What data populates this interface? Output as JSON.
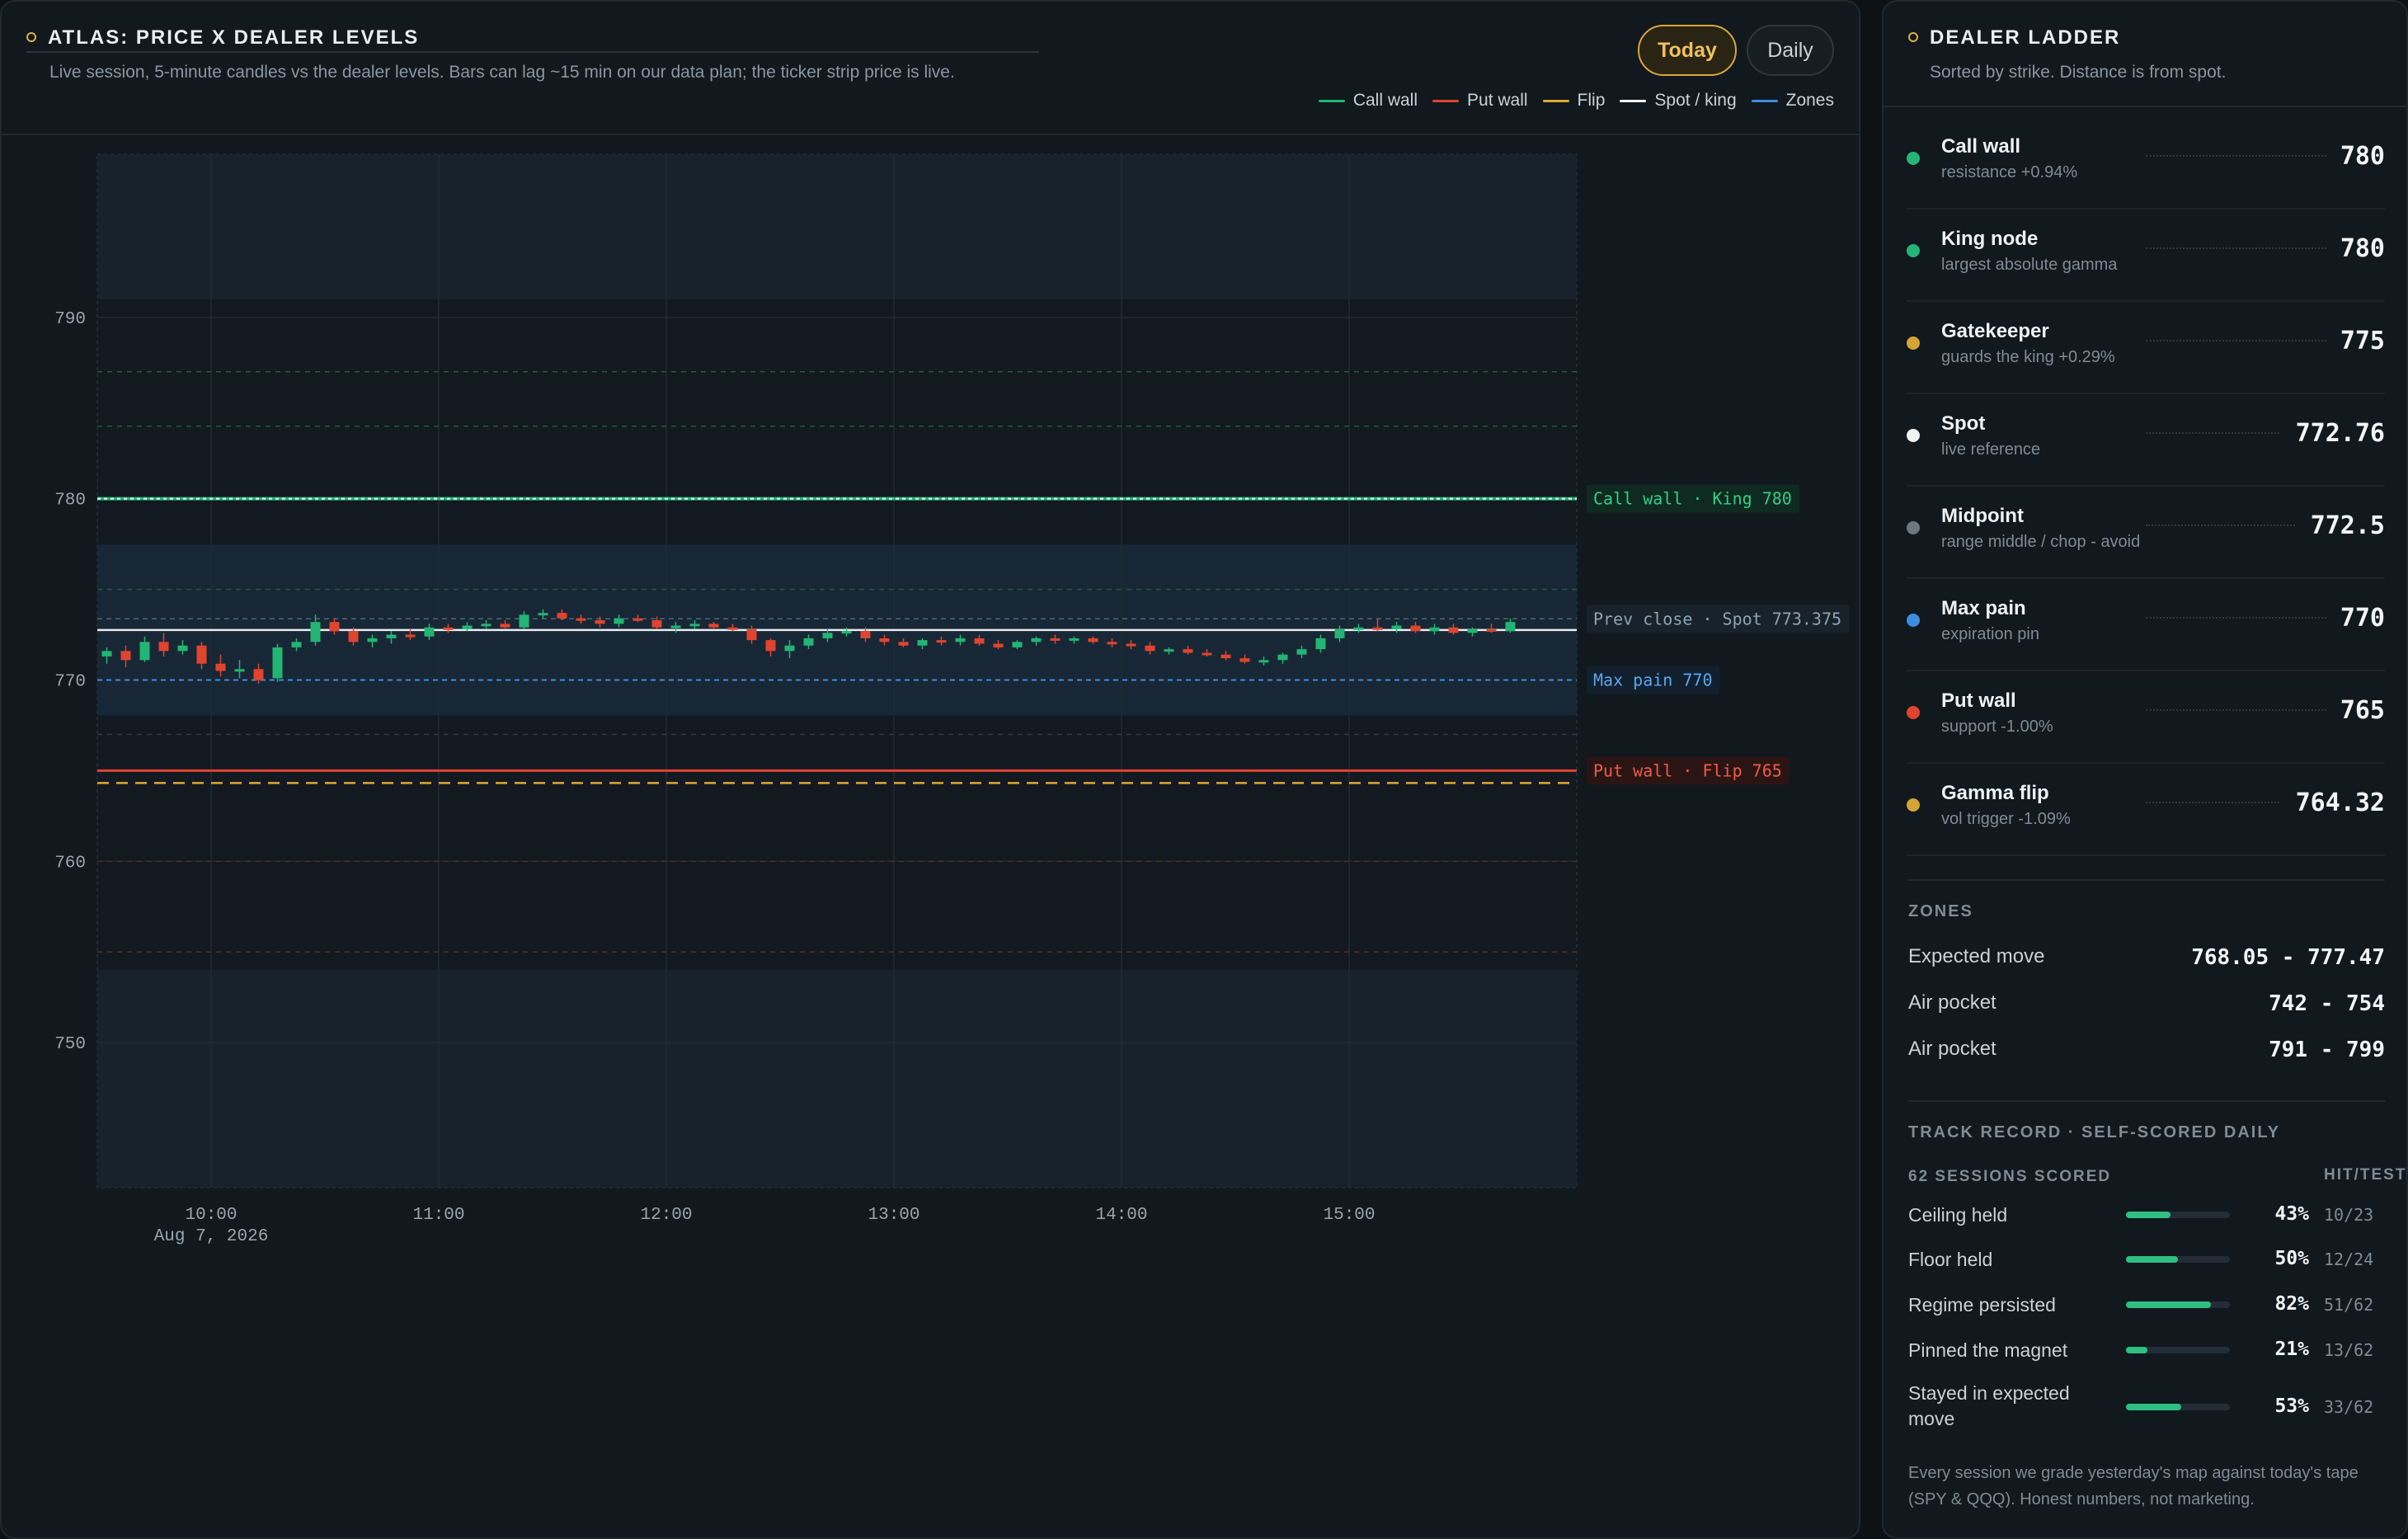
{
  "chart_panel": {
    "title": "ATLAS: PRICE X DEALER LEVELS",
    "subtitle": "Live session, 5-minute candles vs the dealer levels. Bars can lag ~15 min on our data plan; the ticker strip price is live.",
    "toggle": {
      "today": "Today",
      "daily": "Daily",
      "active": "Today"
    },
    "legend": [
      {
        "label": "Call wall",
        "color": "#22b573"
      },
      {
        "label": "Put wall",
        "color": "#e0442f"
      },
      {
        "label": "Flip",
        "color": "#e0a731"
      },
      {
        "label": "Spot / king",
        "color": "#ffffff"
      },
      {
        "label": "Zones",
        "color": "#3c8ee0"
      }
    ],
    "level_tags": {
      "call_king": "Call wall · King 780",
      "prev_spot": "Prev close · Spot 773.375",
      "max_pain": "Max pain 770",
      "put_flip": "Put wall · Flip 765"
    },
    "date_label": "Aug 7, 2026"
  },
  "chart_data": {
    "type": "candlestick",
    "x_ticks": [
      "10:00",
      "11:00",
      "12:00",
      "13:00",
      "14:00",
      "15:00"
    ],
    "y_ticks": [
      750,
      760,
      770,
      780,
      790
    ],
    "ylim": [
      742,
      799
    ],
    "session": {
      "start": "09:30",
      "end": "16:00",
      "interval_min": 5
    },
    "levels": {
      "call_wall": 780,
      "king_node": 780,
      "gatekeeper": 775,
      "spot": 772.76,
      "prev_close": 773.375,
      "midpoint": 772.5,
      "max_pain": 770,
      "put_wall": 765,
      "gamma_flip": 764.32,
      "expected_move": [
        768.05,
        777.47
      ],
      "air_pockets": [
        [
          742,
          754
        ],
        [
          791,
          799
        ]
      ]
    },
    "candles": [
      [
        771.3,
        771.8,
        770.9,
        771.6
      ],
      [
        771.6,
        771.9,
        770.7,
        771.1
      ],
      [
        771.1,
        772.4,
        771.0,
        772.1
      ],
      [
        772.1,
        772.6,
        771.3,
        771.6
      ],
      [
        771.6,
        772.2,
        771.4,
        771.9
      ],
      [
        771.9,
        772.1,
        770.6,
        770.9
      ],
      [
        770.9,
        771.4,
        770.2,
        770.5
      ],
      [
        770.5,
        771.1,
        770.1,
        770.6
      ],
      [
        770.6,
        770.9,
        769.8,
        770.0
      ],
      [
        770.1,
        772.0,
        769.9,
        771.8
      ],
      [
        771.8,
        772.3,
        771.6,
        772.1
      ],
      [
        772.1,
        773.6,
        771.9,
        773.2
      ],
      [
        773.2,
        773.4,
        772.5,
        772.7
      ],
      [
        772.7,
        772.9,
        771.9,
        772.1
      ],
      [
        772.1,
        772.5,
        771.8,
        772.3
      ],
      [
        772.3,
        772.7,
        772.0,
        772.5
      ],
      [
        772.5,
        772.8,
        772.2,
        772.4
      ],
      [
        772.4,
        773.1,
        772.2,
        772.9
      ],
      [
        772.9,
        773.1,
        772.6,
        772.8
      ],
      [
        772.8,
        773.2,
        772.7,
        773.0
      ],
      [
        773.0,
        773.3,
        772.8,
        773.1
      ],
      [
        773.1,
        773.3,
        772.8,
        772.9
      ],
      [
        772.9,
        773.8,
        772.8,
        773.6
      ],
      [
        773.6,
        773.9,
        773.4,
        773.7
      ],
      [
        773.7,
        773.9,
        773.3,
        773.4
      ],
      [
        773.4,
        773.6,
        773.1,
        773.3
      ],
      [
        773.3,
        773.5,
        772.9,
        773.1
      ],
      [
        773.1,
        773.6,
        772.9,
        773.4
      ],
      [
        773.4,
        773.6,
        773.2,
        773.3
      ],
      [
        773.3,
        773.5,
        772.8,
        772.9
      ],
      [
        772.9,
        773.2,
        772.6,
        773.0
      ],
      [
        773.0,
        773.3,
        772.8,
        773.1
      ],
      [
        773.1,
        773.2,
        772.8,
        772.9
      ],
      [
        772.9,
        773.1,
        772.7,
        772.8
      ],
      [
        772.8,
        773.0,
        772.0,
        772.2
      ],
      [
        772.2,
        772.3,
        771.3,
        771.6
      ],
      [
        771.6,
        772.2,
        771.2,
        771.9
      ],
      [
        771.9,
        772.5,
        771.7,
        772.3
      ],
      [
        772.3,
        772.8,
        772.1,
        772.6
      ],
      [
        772.6,
        772.9,
        772.4,
        772.7
      ],
      [
        772.7,
        772.9,
        772.1,
        772.3
      ],
      [
        772.3,
        772.5,
        771.9,
        772.1
      ],
      [
        772.1,
        772.3,
        771.8,
        771.9
      ],
      [
        771.9,
        772.3,
        771.7,
        772.2
      ],
      [
        772.2,
        772.4,
        771.9,
        772.1
      ],
      [
        772.1,
        772.5,
        771.9,
        772.3
      ],
      [
        772.3,
        772.5,
        771.9,
        772.0
      ],
      [
        772.0,
        772.2,
        771.7,
        771.8
      ],
      [
        771.8,
        772.2,
        771.7,
        772.1
      ],
      [
        772.1,
        772.4,
        771.9,
        772.3
      ],
      [
        772.3,
        772.5,
        772.0,
        772.2
      ],
      [
        772.2,
        772.4,
        772.0,
        772.3
      ],
      [
        772.3,
        772.4,
        772.0,
        772.1
      ],
      [
        772.1,
        772.3,
        771.8,
        772.0
      ],
      [
        772.0,
        772.2,
        771.7,
        771.9
      ],
      [
        771.9,
        772.1,
        771.4,
        771.6
      ],
      [
        771.6,
        771.8,
        771.4,
        771.7
      ],
      [
        771.7,
        771.9,
        771.4,
        771.5
      ],
      [
        771.5,
        771.7,
        771.3,
        771.4
      ],
      [
        771.4,
        771.6,
        771.1,
        771.2
      ],
      [
        771.2,
        771.4,
        770.9,
        771.0
      ],
      [
        771.0,
        771.3,
        770.8,
        771.1
      ],
      [
        771.1,
        771.5,
        770.9,
        771.4
      ],
      [
        771.4,
        771.9,
        771.2,
        771.7
      ],
      [
        771.7,
        772.5,
        771.5,
        772.3
      ],
      [
        772.3,
        773.0,
        772.1,
        772.8
      ],
      [
        772.8,
        773.1,
        772.6,
        772.9
      ],
      [
        772.9,
        773.4,
        772.7,
        772.8
      ],
      [
        772.8,
        773.2,
        772.6,
        773.0
      ],
      [
        773.0,
        773.2,
        772.6,
        772.7
      ],
      [
        772.7,
        773.1,
        772.5,
        772.9
      ],
      [
        772.9,
        773.1,
        772.5,
        772.6
      ],
      [
        772.6,
        772.9,
        772.4,
        772.8
      ],
      [
        772.8,
        773.1,
        772.6,
        772.7
      ],
      [
        772.7,
        773.4,
        772.6,
        773.2
      ]
    ]
  },
  "ladder_panel": {
    "title": "DEALER LADDER",
    "subtitle": "Sorted by strike. Distance is from spot.",
    "items": [
      {
        "name": "Call wall",
        "desc": "resistance +0.94%",
        "value": "780",
        "color": "#22b573"
      },
      {
        "name": "King node",
        "desc": "largest absolute gamma",
        "value": "780",
        "color": "#22b573"
      },
      {
        "name": "Gatekeeper",
        "desc": "guards the king +0.29%",
        "value": "775",
        "color": "#d4a534"
      },
      {
        "name": "Spot",
        "desc": "live reference",
        "value": "772.76",
        "color": "#f2f2f2"
      },
      {
        "name": "Midpoint",
        "desc": "range middle / chop - avoid",
        "value": "772.5",
        "color": "#6d7780"
      },
      {
        "name": "Max pain",
        "desc": "expiration pin",
        "value": "770",
        "color": "#3c8ee0"
      },
      {
        "name": "Put wall",
        "desc": "support -1.00%",
        "value": "765",
        "color": "#e0442f"
      },
      {
        "name": "Gamma flip",
        "desc": "vol trigger -1.09%",
        "value": "764.32",
        "color": "#d4a534"
      }
    ],
    "zones_label": "ZONES",
    "zones": [
      {
        "name": "Expected move",
        "value": "768.05 - 777.47"
      },
      {
        "name": "Air pocket",
        "value": "742 - 754"
      },
      {
        "name": "Air pocket",
        "value": "791 - 799"
      }
    ],
    "track": {
      "label": "TRACK RECORD · SELF-SCORED DAILY",
      "sessions": "62 SESSIONS SCORED",
      "col_header": "HIT/TEST",
      "rows": [
        {
          "name": "Ceiling held",
          "pct": "43%",
          "count": "10/23",
          "fraction": 0.43
        },
        {
          "name": "Floor held",
          "pct": "50%",
          "count": "12/24",
          "fraction": 0.5
        },
        {
          "name": "Regime persisted",
          "pct": "82%",
          "count": "51/62",
          "fraction": 0.82
        },
        {
          "name": "Pinned the magnet",
          "pct": "21%",
          "count": "13/62",
          "fraction": 0.21
        },
        {
          "name": "Stayed in expected move",
          "pct": "53%",
          "count": "33/62",
          "fraction": 0.53
        }
      ],
      "footnote": "Every session we grade yesterday's map against today's tape (SPY & QQQ). Honest numbers, not marketing."
    }
  }
}
